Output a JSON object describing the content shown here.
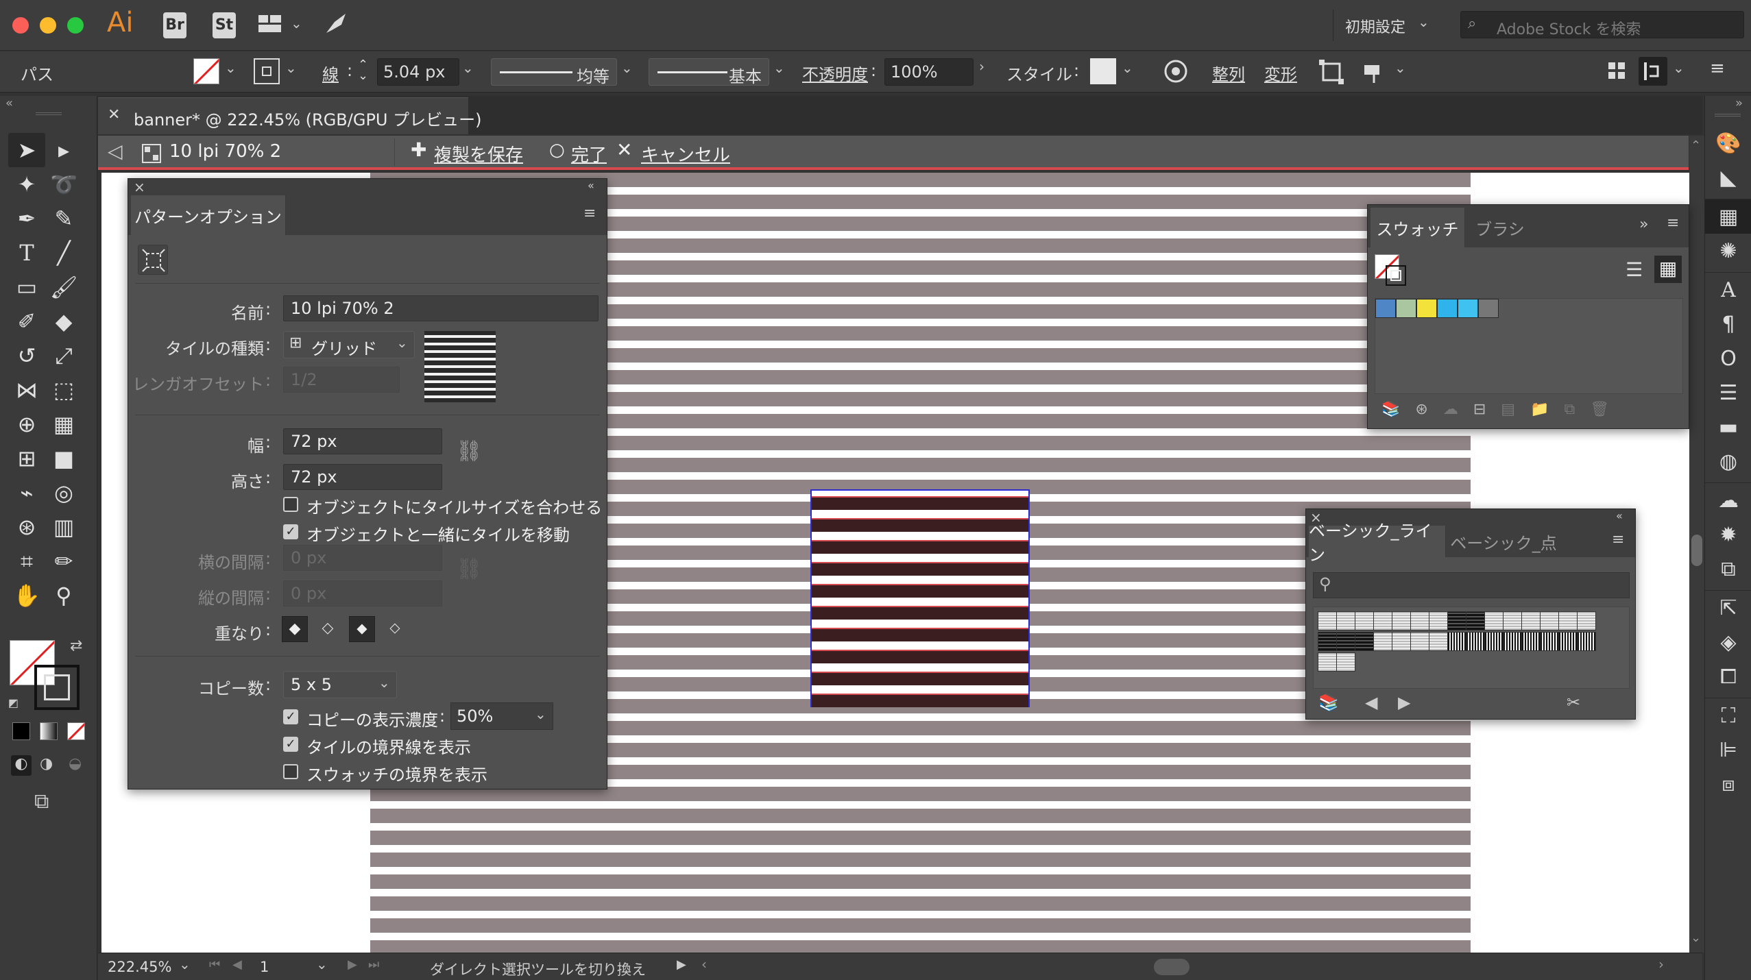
{
  "app": {
    "logo": "Ai",
    "bridge": "Br",
    "stock": "St",
    "workspace": "初期設定",
    "search_placeholder": "Adobe Stock を検索"
  },
  "controlbar": {
    "selection_label": "パス",
    "stroke_label": "線",
    "stroke_value": "5.04 px",
    "profile_label": "均等",
    "brush_label": "基本",
    "opacity_label": "不透明度",
    "opacity_value": "100%",
    "style_label": "スタイル",
    "align_label": "整列",
    "transform_label": "変形"
  },
  "document": {
    "tab_title": "banner* @ 222.45% (RGB/GPU プレビュー)",
    "isolation_name": "10 lpi 70% 2",
    "save_copy": "複製を保存",
    "done": "完了",
    "cancel": "キャンセル"
  },
  "pattern_options": {
    "title": "パターンオプション",
    "name_label": "名前",
    "name_value": "10 lpi 70% 2",
    "tile_type_label": "タイルの種類",
    "tile_type_value": "グリッド",
    "brick_offset_label": "レンガオフセット",
    "brick_offset_value": "1/2",
    "width_label": "幅",
    "width_value": "72 px",
    "height_label": "高さ",
    "height_value": "72 px",
    "size_tile_to_art": "オブジェクトにタイルサイズを合わせる",
    "size_tile_to_art_checked": false,
    "move_tile_with_art": "オブジェクトと一緒にタイルを移動",
    "move_tile_with_art_checked": true,
    "h_spacing_label": "横の間隔",
    "h_spacing_value": "0 px",
    "v_spacing_label": "縦の間隔",
    "v_spacing_value": "0 px",
    "overlap_label": "重なり",
    "copies_label": "コピー数",
    "copies_value": "5 x 5",
    "dim_copies": "コピーの表示濃度",
    "dim_copies_checked": true,
    "dim_copies_value": "50%",
    "show_tile_edge": "タイルの境界線を表示",
    "show_tile_edge_checked": true,
    "show_swatch_bounds": "スウォッチの境界を表示",
    "show_swatch_bounds_checked": false
  },
  "swatches_panel": {
    "tab_active": "スウォッチ",
    "tab_inactive": "ブラシ",
    "chip_colors": [
      "#4f86c6",
      "#a9c6a0",
      "#f3e23a",
      "#2eb4ea",
      "#3fc2f0",
      "#777777"
    ]
  },
  "basic_lines_panel": {
    "tab_active": "ベーシック_ライン",
    "tab_inactive": "ベーシック_点"
  },
  "statusbar": {
    "zoom": "222.45%",
    "artboard": "1",
    "tool_hint": "ダイレクト選択ツールを切り換え"
  },
  "colors": {
    "accent_red": "#d6494f",
    "stripe": "#908486",
    "tile_dark": "#3a1e20",
    "selection_blue": "#2b2bd6"
  }
}
